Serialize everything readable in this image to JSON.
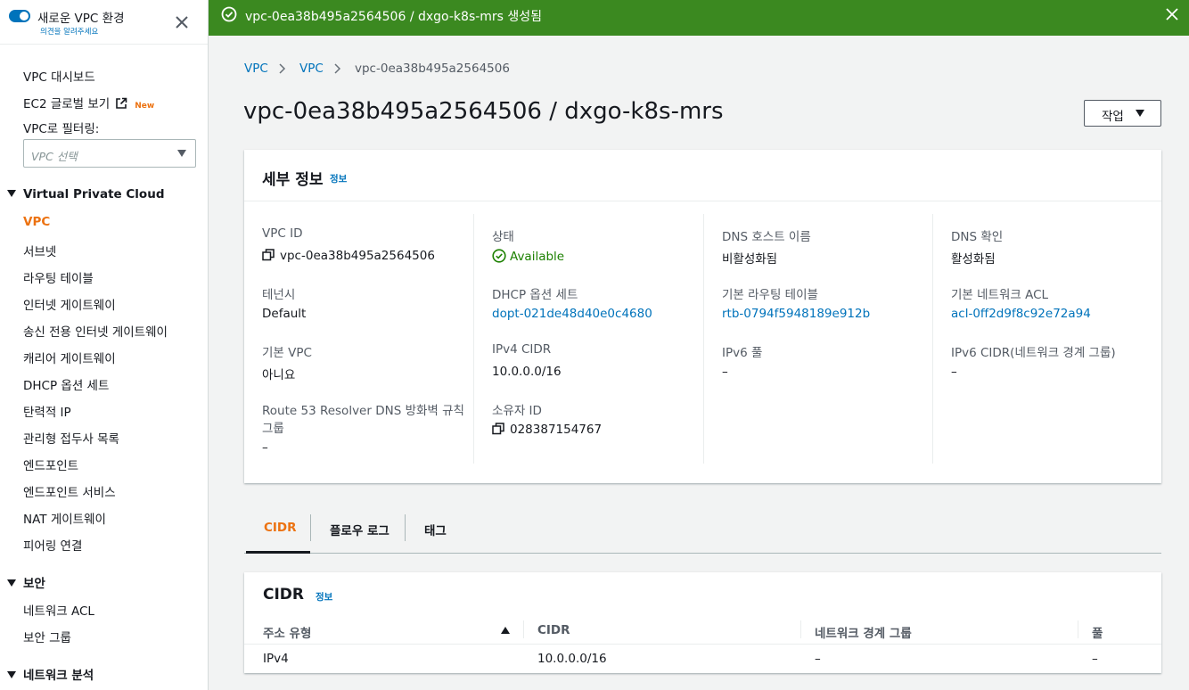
{
  "sidebar": {
    "title": "새로운 VPC 환경",
    "feedback": "의견을 알려주세요",
    "dashboard": "VPC 대시보드",
    "ec2_global": "EC2 글로벌 보기",
    "new_badge": "New",
    "filter_label": "VPC로 필터링:",
    "filter_placeholder": "VPC 선택",
    "section_vpc": "Virtual Private Cloud",
    "vpc_items": [
      "VPC",
      "서브넷",
      "라우팅 테이블",
      "인터넷 게이트웨이",
      "송신 전용 인터넷 게이트웨이",
      "캐리어 게이트웨이",
      "DHCP 옵션 세트",
      "탄력적 IP",
      "관리형 접두사 목록",
      "엔드포인트",
      "엔드포인트 서비스",
      "NAT 게이트웨이",
      "피어링 연결"
    ],
    "section_security": "보안",
    "security_items": [
      "네트워크 ACL",
      "보안 그룹"
    ],
    "section_network": "네트워크 분석"
  },
  "flash": {
    "message": "vpc-0ea38b495a2564506 / dxgo-k8s-mrs 생성됨",
    "color": "#3b8920"
  },
  "breadcrumb": [
    "VPC",
    "VPC",
    "vpc-0ea38b495a2564506"
  ],
  "page_title": "vpc-0ea38b495a2564506 / dxgo-k8s-mrs",
  "actions_label": "작업",
  "details": {
    "title": "세부 정보",
    "info": "정보",
    "vpc_id_label": "VPC ID",
    "vpc_id": "vpc-0ea38b495a2564506",
    "tenancy_label": "테넌시",
    "tenancy": "Default",
    "default_vpc_label": "기본 VPC",
    "default_vpc": "아니요",
    "route53_label_1": "Route 53 Resolver DNS 방화벽 규칙",
    "route53_label_2": "그룹",
    "route53": "–",
    "state_label": "상태",
    "state": "Available",
    "dhcp_label": "DHCP 옵션 세트",
    "dhcp": "dopt-021de48d40e0c4680",
    "ipv4_cidr_label": "IPv4 CIDR",
    "ipv4_cidr": "10.0.0.0/16",
    "owner_label": "소유자 ID",
    "owner": "028387154767",
    "dns_hostnames_label": "DNS 호스트 이름",
    "dns_hostnames": "비활성화됨",
    "main_rt_label": "기본 라우팅 테이블",
    "main_rt": "rtb-0794f5948189e912b",
    "ipv6_pool_label": "IPv6 풀",
    "ipv6_pool": "–",
    "dns_resolution_label": "DNS 확인",
    "dns_resolution": "활성화됨",
    "main_acl_label": "기본 네트워크 ACL",
    "main_acl": "acl-0ff2d9f8c92e72a94",
    "ipv6_cidr_label": "IPv6 CIDR(네트워크 경계 그룹)",
    "ipv6_cidr": "–"
  },
  "tabs": [
    "CIDR",
    "플로우 로그",
    "태그"
  ],
  "cidr_panel": {
    "title": "CIDR",
    "info": "정보",
    "columns": [
      "주소 유형",
      "CIDR",
      "네트워크 경계 그룹",
      "풀"
    ],
    "rows": [
      [
        "IPv4",
        "10.0.0.0/16",
        "–",
        "–"
      ]
    ]
  },
  "colors": {
    "accent": "#ec7211",
    "link": "#0073bb",
    "success": "#1d8102"
  }
}
